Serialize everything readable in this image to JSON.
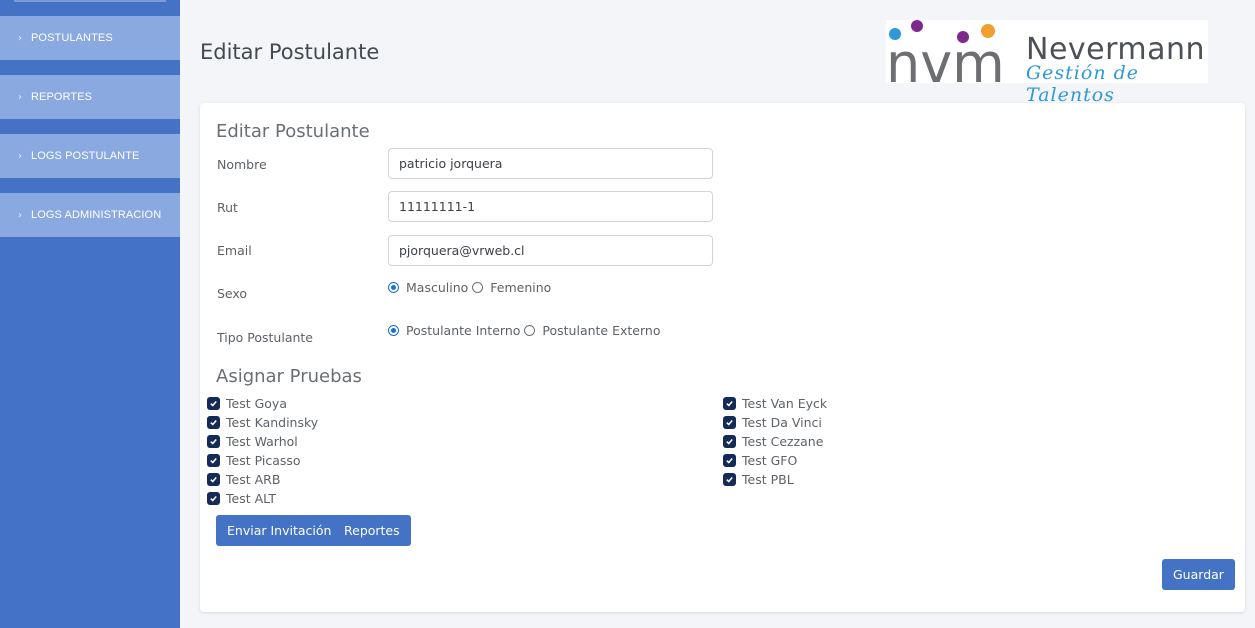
{
  "sidebar": {
    "items": [
      {
        "label": "POSTULANTES"
      },
      {
        "label": "REPORTES"
      },
      {
        "label": "LOGS POSTULANTE"
      },
      {
        "label": "LOGS ADMINISTRACION"
      }
    ]
  },
  "header": {
    "title": "Editar Postulante",
    "logo_name": "Nevermann",
    "logo_tagline": "Gestión de Talentos",
    "logo_mark": "nvm"
  },
  "form": {
    "title": "Editar Postulante",
    "fields": [
      {
        "label": "Nombre",
        "value": "patricio jorquera"
      },
      {
        "label": "Rut",
        "value": "11111111-1"
      },
      {
        "label": "Email",
        "value": "pjorquera@vrweb.cl"
      }
    ],
    "sexo": {
      "label": "Sexo",
      "options": [
        "Masculino",
        "Femenino"
      ],
      "selected": "Masculino"
    },
    "tipo": {
      "label": "Tipo Postulante",
      "options": [
        "Postulante Interno",
        "Postulante Externo"
      ],
      "selected": "Postulante Interno"
    }
  },
  "tests": {
    "title": "Asignar Pruebas",
    "left": [
      {
        "label": "Test Goya",
        "checked": true
      },
      {
        "label": "Test Kandinsky",
        "checked": true
      },
      {
        "label": "Test Warhol",
        "checked": true
      },
      {
        "label": "Test Picasso",
        "checked": true
      },
      {
        "label": "Test ARB",
        "checked": true
      },
      {
        "label": "Test ALT",
        "checked": true
      }
    ],
    "right": [
      {
        "label": "Test Van Eyck",
        "checked": true
      },
      {
        "label": "Test Da Vinci",
        "checked": true
      },
      {
        "label": "Test Cezzane",
        "checked": true
      },
      {
        "label": "Test GFO",
        "checked": true
      },
      {
        "label": "Test PBL",
        "checked": true
      }
    ]
  },
  "buttons": {
    "invite": "Enviar Invitación",
    "reports": "Reportes",
    "save": "Guardar"
  },
  "colors": {
    "sidebar": "#4472c4",
    "sidebar_item": "#8aa9e0",
    "primary_button": "#4472c4",
    "checkbox": "#142a57",
    "logo_blue": "#2f98d6",
    "logo_purple": "#7b2a8c",
    "logo_orange": "#f0a030"
  }
}
